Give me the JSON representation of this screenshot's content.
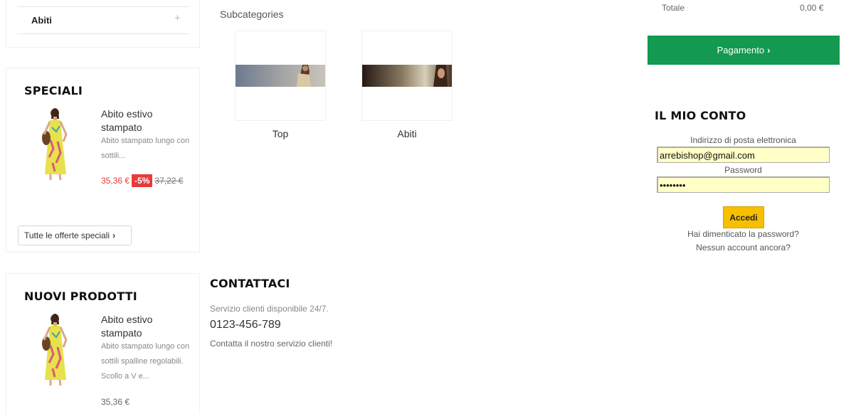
{
  "categories": {
    "item": "Abiti",
    "expand_symbol": "+"
  },
  "specials": {
    "title": "SPECIALI",
    "product": {
      "name": "Abito estivo stampato",
      "description": "Abito stampato lungo con sottili...",
      "price_new": "35,36 €",
      "discount": "-5%",
      "price_old": "37,22 €"
    },
    "all_button": "Tutte le offerte speciali",
    "chevron": "›"
  },
  "new_products": {
    "title": "NUOVI PRODOTTI",
    "product": {
      "name": "Abito estivo stampato",
      "description": "Abito stampato lungo con sottili spalline regolabili. Scollo a V e...",
      "price": "35,36 €"
    }
  },
  "subcategories": {
    "title": "Subcategories",
    "items": [
      {
        "label": "Top"
      },
      {
        "label": "Abiti"
      }
    ]
  },
  "contact": {
    "title": "CONTATTACI",
    "service": "Servizio clienti disponibile 24/7.",
    "phone": "0123-456-789",
    "cta": "Contatta il nostro servizio clienti!"
  },
  "cart": {
    "total_label": "Totale",
    "total_value": "0,00 €",
    "pay_button": "Pagamento",
    "chevron": "›"
  },
  "account": {
    "title": "IL MIO CONTO",
    "email_label": "Indirizzo di posta elettronica",
    "email_value": "arrebishop@gmail.com",
    "password_label": "Password",
    "password_value": "••••••••",
    "login_button": "Accedi",
    "forgot_link": "Hai dimenticato la password?",
    "register_link": "Nessun account ancora?"
  },
  "colors": {
    "accent_green": "#149950",
    "sale_red": "#e73b3b",
    "login_yellow": "#f6c000",
    "autofill_yellow": "#ffffc6"
  }
}
